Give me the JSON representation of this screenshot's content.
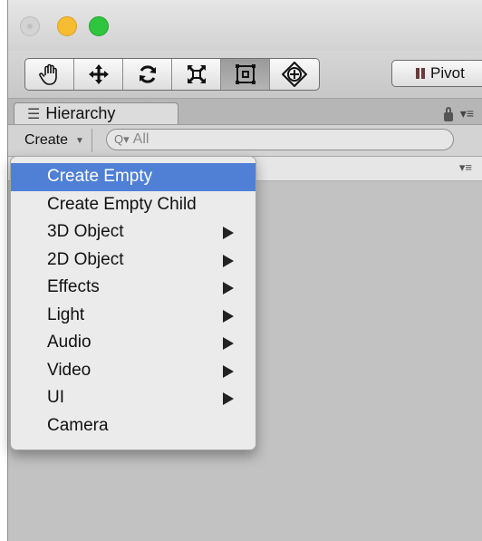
{
  "toolbar": {
    "tools": [
      {
        "name": "hand-tool",
        "icon": "hand-icon"
      },
      {
        "name": "move-tool",
        "icon": "move-icon"
      },
      {
        "name": "rotate-tool",
        "icon": "rotate-icon"
      },
      {
        "name": "scale-tool",
        "icon": "scale-icon"
      },
      {
        "name": "rect-tool",
        "icon": "rect-transform-icon",
        "active": true
      },
      {
        "name": "transform-tool",
        "icon": "transform-icon"
      }
    ],
    "pivot_label": "Pivot"
  },
  "hierarchy": {
    "tab_label": "Hierarchy",
    "create_label": "Create",
    "search_placeholder": "All"
  },
  "menu": {
    "items": [
      {
        "label": "Create Empty",
        "submenu": false,
        "highlighted": true
      },
      {
        "label": "Create Empty Child",
        "submenu": false
      },
      {
        "label": "3D Object",
        "submenu": true
      },
      {
        "label": "2D Object",
        "submenu": true
      },
      {
        "label": "Effects",
        "submenu": true
      },
      {
        "label": "Light",
        "submenu": true
      },
      {
        "label": "Audio",
        "submenu": true
      },
      {
        "label": "Video",
        "submenu": true
      },
      {
        "label": "UI",
        "submenu": true
      },
      {
        "label": "Camera",
        "submenu": false
      }
    ]
  },
  "colors": {
    "highlight": "#4f80d6",
    "close_light": "#d3d3d3",
    "minimize_light": "#f6bd30",
    "zoom_light": "#2fc53f"
  }
}
